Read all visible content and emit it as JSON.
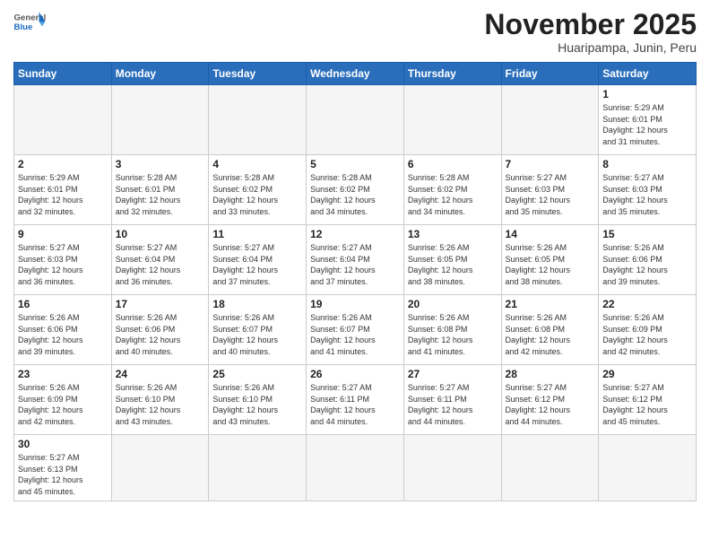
{
  "header": {
    "logo_general": "General",
    "logo_blue": "Blue",
    "month_title": "November 2025",
    "subtitle": "Huaripampa, Junin, Peru"
  },
  "weekdays": [
    "Sunday",
    "Monday",
    "Tuesday",
    "Wednesday",
    "Thursday",
    "Friday",
    "Saturday"
  ],
  "weeks": [
    [
      {
        "day": "",
        "info": ""
      },
      {
        "day": "",
        "info": ""
      },
      {
        "day": "",
        "info": ""
      },
      {
        "day": "",
        "info": ""
      },
      {
        "day": "",
        "info": ""
      },
      {
        "day": "",
        "info": ""
      },
      {
        "day": "1",
        "info": "Sunrise: 5:29 AM\nSunset: 6:01 PM\nDaylight: 12 hours\nand 31 minutes."
      }
    ],
    [
      {
        "day": "2",
        "info": "Sunrise: 5:29 AM\nSunset: 6:01 PM\nDaylight: 12 hours\nand 32 minutes."
      },
      {
        "day": "3",
        "info": "Sunrise: 5:28 AM\nSunset: 6:01 PM\nDaylight: 12 hours\nand 32 minutes."
      },
      {
        "day": "4",
        "info": "Sunrise: 5:28 AM\nSunset: 6:02 PM\nDaylight: 12 hours\nand 33 minutes."
      },
      {
        "day": "5",
        "info": "Sunrise: 5:28 AM\nSunset: 6:02 PM\nDaylight: 12 hours\nand 34 minutes."
      },
      {
        "day": "6",
        "info": "Sunrise: 5:28 AM\nSunset: 6:02 PM\nDaylight: 12 hours\nand 34 minutes."
      },
      {
        "day": "7",
        "info": "Sunrise: 5:27 AM\nSunset: 6:03 PM\nDaylight: 12 hours\nand 35 minutes."
      },
      {
        "day": "8",
        "info": "Sunrise: 5:27 AM\nSunset: 6:03 PM\nDaylight: 12 hours\nand 35 minutes."
      }
    ],
    [
      {
        "day": "9",
        "info": "Sunrise: 5:27 AM\nSunset: 6:03 PM\nDaylight: 12 hours\nand 36 minutes."
      },
      {
        "day": "10",
        "info": "Sunrise: 5:27 AM\nSunset: 6:04 PM\nDaylight: 12 hours\nand 36 minutes."
      },
      {
        "day": "11",
        "info": "Sunrise: 5:27 AM\nSunset: 6:04 PM\nDaylight: 12 hours\nand 37 minutes."
      },
      {
        "day": "12",
        "info": "Sunrise: 5:27 AM\nSunset: 6:04 PM\nDaylight: 12 hours\nand 37 minutes."
      },
      {
        "day": "13",
        "info": "Sunrise: 5:26 AM\nSunset: 6:05 PM\nDaylight: 12 hours\nand 38 minutes."
      },
      {
        "day": "14",
        "info": "Sunrise: 5:26 AM\nSunset: 6:05 PM\nDaylight: 12 hours\nand 38 minutes."
      },
      {
        "day": "15",
        "info": "Sunrise: 5:26 AM\nSunset: 6:06 PM\nDaylight: 12 hours\nand 39 minutes."
      }
    ],
    [
      {
        "day": "16",
        "info": "Sunrise: 5:26 AM\nSunset: 6:06 PM\nDaylight: 12 hours\nand 39 minutes."
      },
      {
        "day": "17",
        "info": "Sunrise: 5:26 AM\nSunset: 6:06 PM\nDaylight: 12 hours\nand 40 minutes."
      },
      {
        "day": "18",
        "info": "Sunrise: 5:26 AM\nSunset: 6:07 PM\nDaylight: 12 hours\nand 40 minutes."
      },
      {
        "day": "19",
        "info": "Sunrise: 5:26 AM\nSunset: 6:07 PM\nDaylight: 12 hours\nand 41 minutes."
      },
      {
        "day": "20",
        "info": "Sunrise: 5:26 AM\nSunset: 6:08 PM\nDaylight: 12 hours\nand 41 minutes."
      },
      {
        "day": "21",
        "info": "Sunrise: 5:26 AM\nSunset: 6:08 PM\nDaylight: 12 hours\nand 42 minutes."
      },
      {
        "day": "22",
        "info": "Sunrise: 5:26 AM\nSunset: 6:09 PM\nDaylight: 12 hours\nand 42 minutes."
      }
    ],
    [
      {
        "day": "23",
        "info": "Sunrise: 5:26 AM\nSunset: 6:09 PM\nDaylight: 12 hours\nand 42 minutes."
      },
      {
        "day": "24",
        "info": "Sunrise: 5:26 AM\nSunset: 6:10 PM\nDaylight: 12 hours\nand 43 minutes."
      },
      {
        "day": "25",
        "info": "Sunrise: 5:26 AM\nSunset: 6:10 PM\nDaylight: 12 hours\nand 43 minutes."
      },
      {
        "day": "26",
        "info": "Sunrise: 5:27 AM\nSunset: 6:11 PM\nDaylight: 12 hours\nand 44 minutes."
      },
      {
        "day": "27",
        "info": "Sunrise: 5:27 AM\nSunset: 6:11 PM\nDaylight: 12 hours\nand 44 minutes."
      },
      {
        "day": "28",
        "info": "Sunrise: 5:27 AM\nSunset: 6:12 PM\nDaylight: 12 hours\nand 44 minutes."
      },
      {
        "day": "29",
        "info": "Sunrise: 5:27 AM\nSunset: 6:12 PM\nDaylight: 12 hours\nand 45 minutes."
      }
    ],
    [
      {
        "day": "30",
        "info": "Sunrise: 5:27 AM\nSunset: 6:13 PM\nDaylight: 12 hours\nand 45 minutes."
      },
      {
        "day": "",
        "info": ""
      },
      {
        "day": "",
        "info": ""
      },
      {
        "day": "",
        "info": ""
      },
      {
        "day": "",
        "info": ""
      },
      {
        "day": "",
        "info": ""
      },
      {
        "day": "",
        "info": ""
      }
    ]
  ]
}
